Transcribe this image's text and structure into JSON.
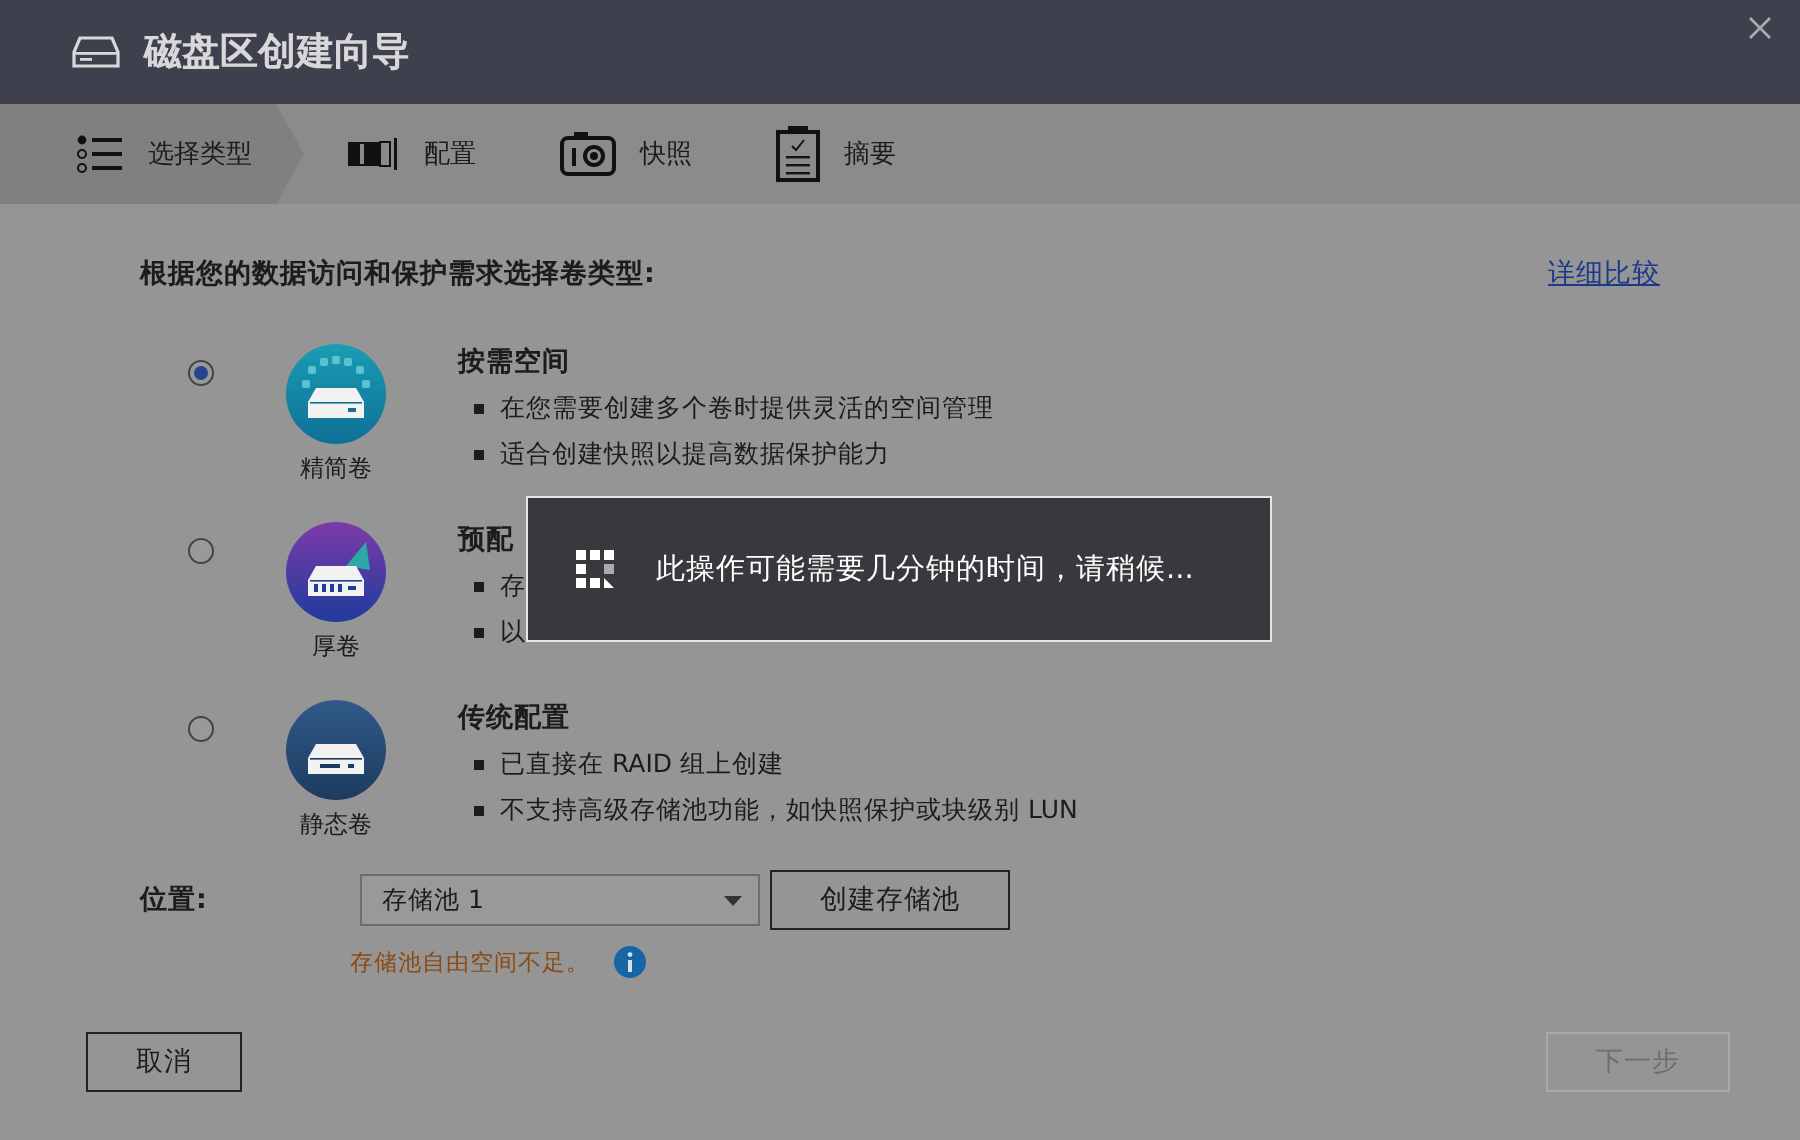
{
  "window": {
    "title": "磁盘区创建向导"
  },
  "steps": [
    {
      "kind": "type",
      "label": "选择类型",
      "selected": true
    },
    {
      "kind": "config",
      "label": "配置",
      "selected": false
    },
    {
      "kind": "snapshot",
      "label": "快照",
      "selected": false
    },
    {
      "kind": "summary",
      "label": "摘要",
      "selected": false
    }
  ],
  "prompt": "根据您的数据访问和保护需求选择卷类型:",
  "compare_link": "详细比较",
  "options": [
    {
      "kind": "thin",
      "name": "精简卷",
      "selected": true,
      "heading": "按需空间",
      "bullets": [
        "在您需要创建多个卷时提供灵活的空间管理",
        "适合创建快照以提高数据保护能力"
      ]
    },
    {
      "kind": "thick",
      "name": "厚卷",
      "selected": false,
      "heading": "预配",
      "bullets": [
        "存",
        "以"
      ]
    },
    {
      "kind": "static",
      "name": "静态卷",
      "selected": false,
      "heading": "传统配置",
      "bullets": [
        "已直接在 RAID 组上创建",
        "不支持高级存储池功能，如快照保护或块级别 LUN"
      ]
    }
  ],
  "location": {
    "label": "位置:",
    "value": "存储池 1",
    "create_button": "创建存储池",
    "warning": "存储池自由空间不足。"
  },
  "buttons": [
    {
      "label": "取消",
      "disabled": false
    },
    {
      "label": "下一步",
      "disabled": true
    }
  ],
  "toast": {
    "message": "此操作可能需要几分钟的时间，请稍候..."
  }
}
